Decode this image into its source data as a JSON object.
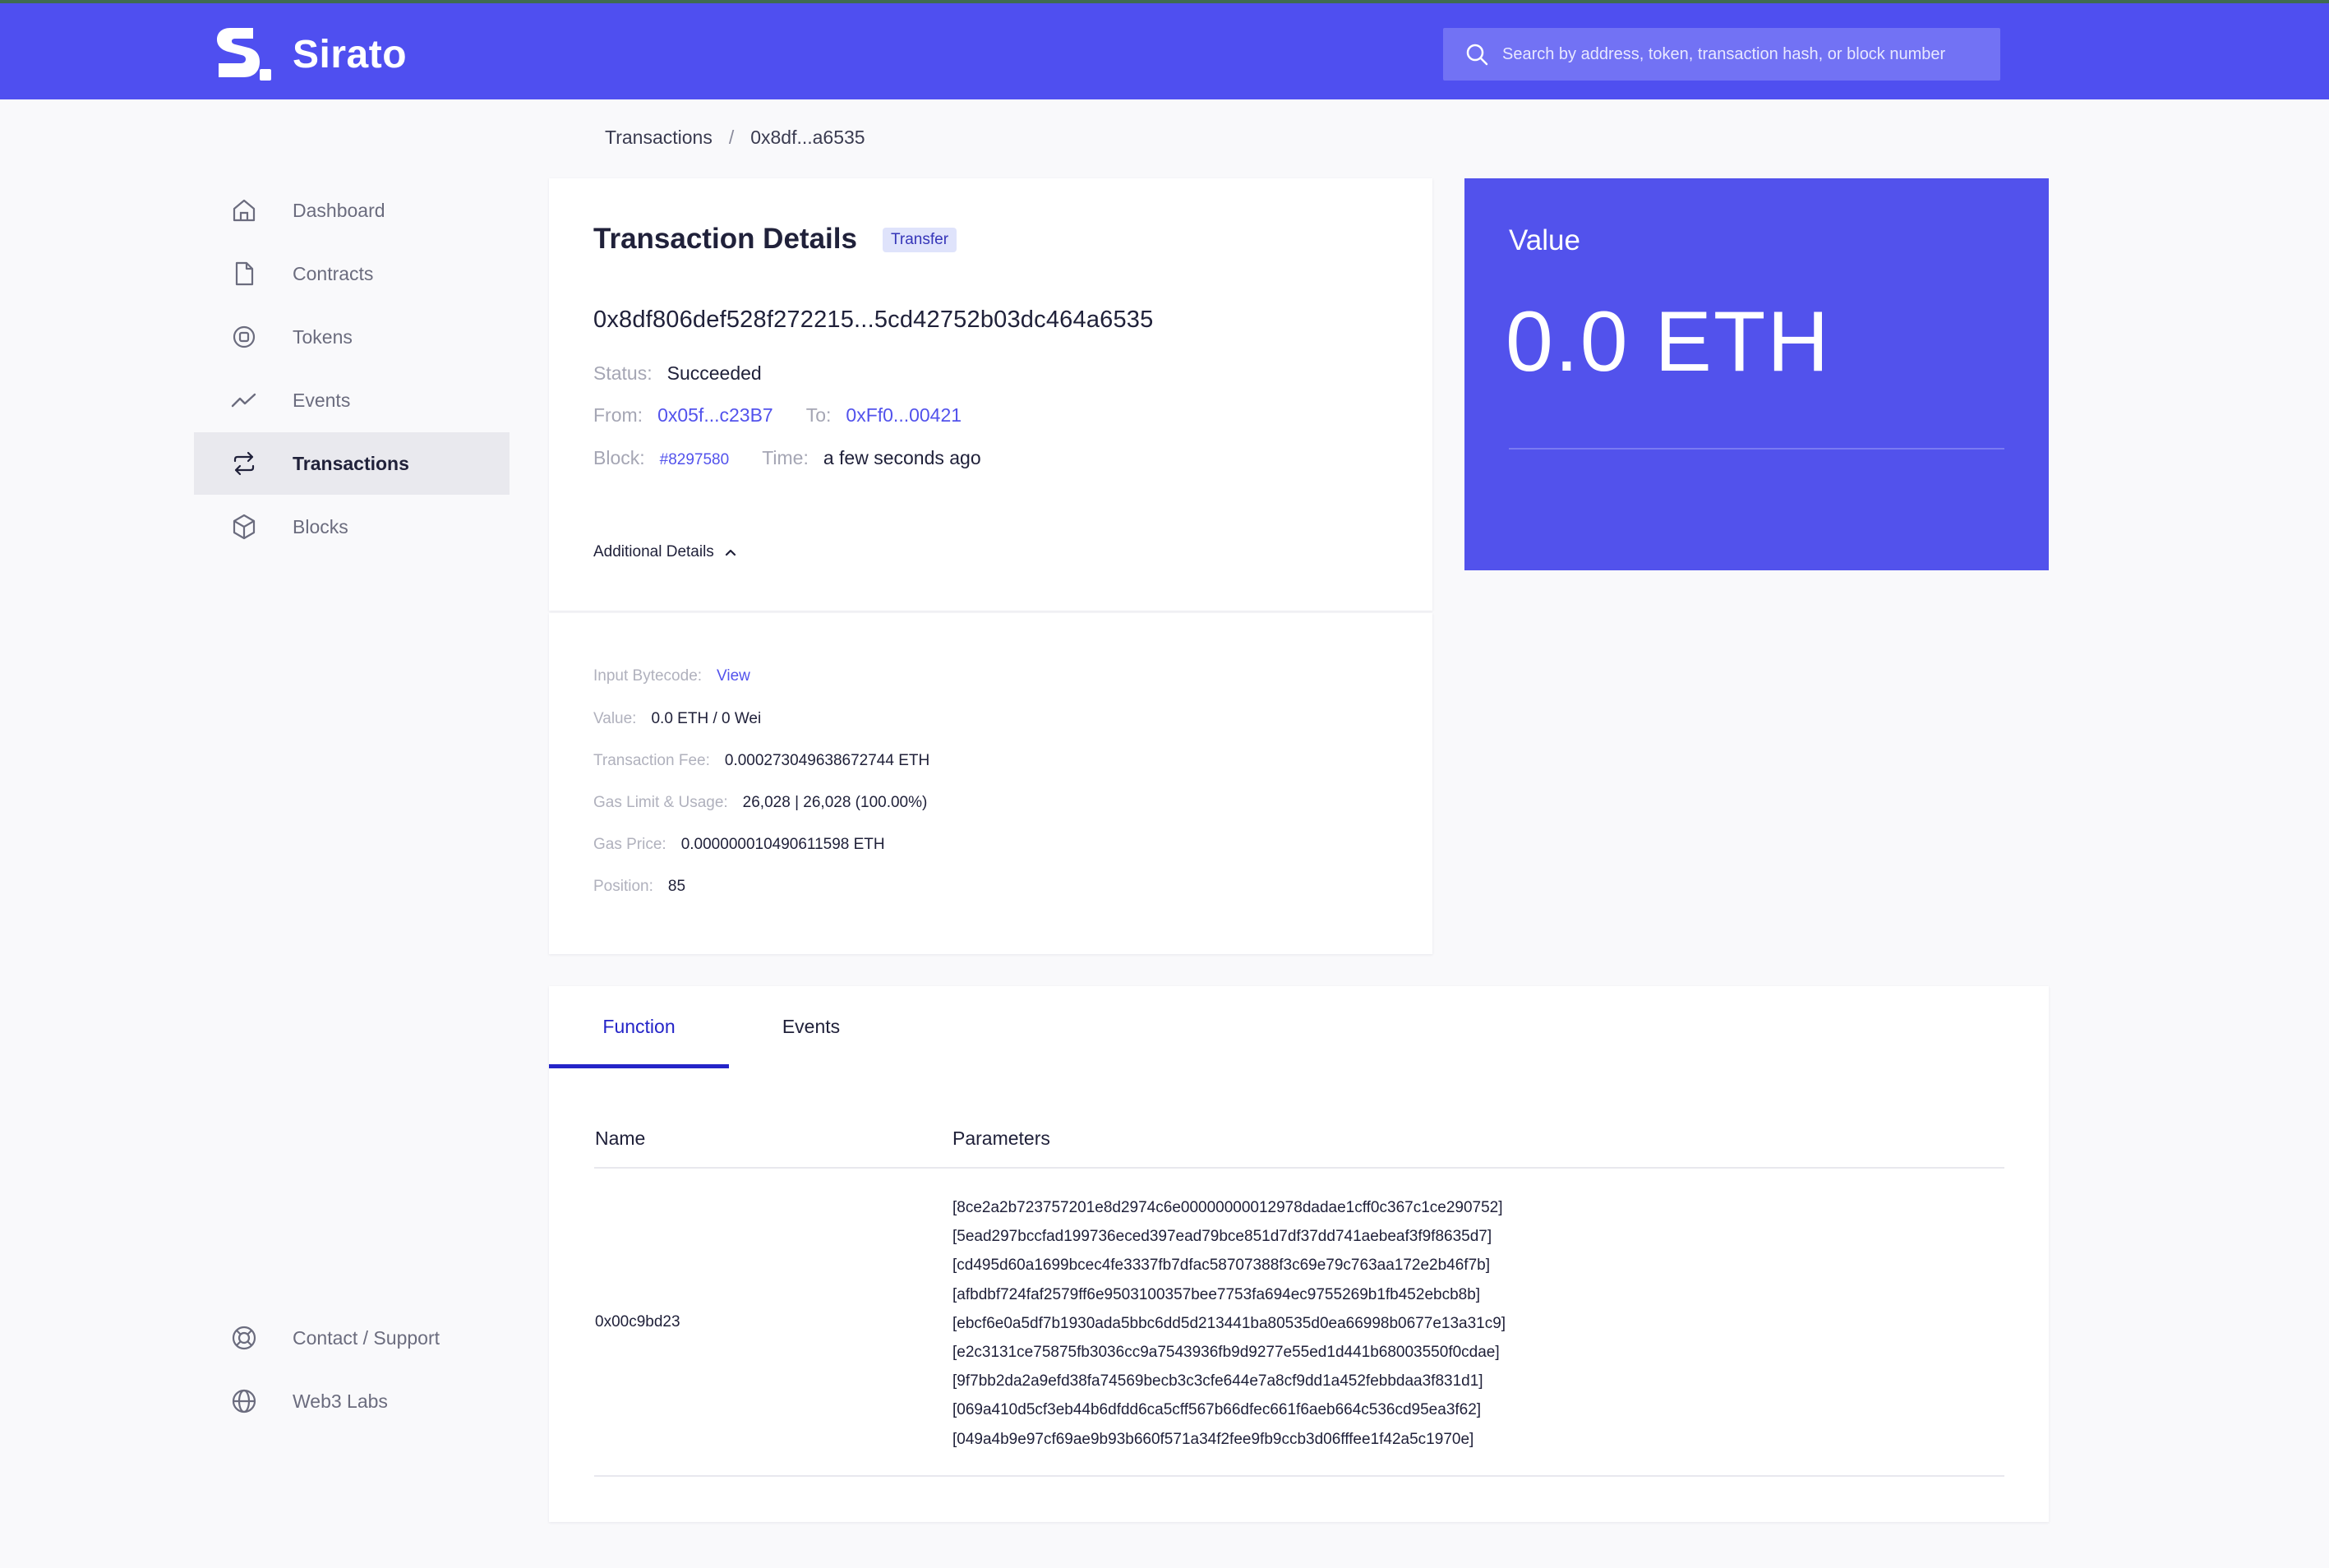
{
  "app": {
    "name": "Sirato",
    "brand_color": "#4f4ff0"
  },
  "search": {
    "placeholder": "Search by address, token, transaction hash, or block number",
    "icon": "search-icon"
  },
  "sidebar": {
    "items": [
      {
        "label": "Dashboard",
        "icon": "home-icon",
        "active": false
      },
      {
        "label": "Contracts",
        "icon": "document-icon",
        "active": false
      },
      {
        "label": "Tokens",
        "icon": "token-icon",
        "active": false
      },
      {
        "label": "Events",
        "icon": "trend-icon",
        "active": false
      },
      {
        "label": "Transactions",
        "icon": "transfer-icon",
        "active": true
      },
      {
        "label": "Blocks",
        "icon": "cube-icon",
        "active": false
      }
    ],
    "bottom_items": [
      {
        "label": "Contact / Support",
        "icon": "lifebuoy-icon"
      },
      {
        "label": "Web3 Labs",
        "icon": "globe-icon"
      }
    ]
  },
  "breadcrumb": {
    "items": [
      "Transactions",
      "0x8df...a6535"
    ],
    "separator": "/"
  },
  "details": {
    "title": "Transaction Details",
    "badge": "Transfer",
    "hash": "0x8df806def528f272215...5cd42752b03dc464a6535",
    "status_label": "Status:",
    "status_value": "Succeeded",
    "from_label": "From:",
    "from_value": "0x05f...c23B7",
    "to_label": "To:",
    "to_value": "0xFf0...00421",
    "block_label": "Block:",
    "block_value": "#8297580",
    "time_label": "Time:",
    "time_value": "a few seconds ago",
    "additional_toggle": "Additional Details"
  },
  "additional": {
    "input_bytecode_label": "Input Bytecode:",
    "input_bytecode_link": "View",
    "value_label": "Value:",
    "value_value": "0.0 ETH / 0 Wei",
    "fee_label": "Transaction Fee:",
    "fee_value": "0.000273049638672744 ETH",
    "gas_label": "Gas Limit & Usage:",
    "gas_value": "26,028 | 26,028 (100.00%)",
    "gas_price_label": "Gas Price:",
    "gas_price_value": "0.000000010490611598 ETH",
    "position_label": "Position:",
    "position_value": "85"
  },
  "value_card": {
    "title": "Value",
    "amount": "0.0 ETH",
    "color": "#5252ec"
  },
  "function_panel": {
    "tabs": [
      {
        "label": "Function",
        "active": true
      },
      {
        "label": "Events",
        "active": false
      }
    ],
    "columns": [
      "Name",
      "Parameters"
    ],
    "rows": [
      {
        "name": "0x00c9bd23",
        "parameters": [
          "[8ce2a2b723757201e8d2974c6e00000000012978dadae1cff0c367c1ce290752]",
          "[5ead297bccfad199736eced397ead79bce851d7df37dd741aebeaf3f9f8635d7]",
          "[cd495d60a1699bcec4fe3337fb7dfac58707388f3c69e79c763aa172e2b46f7b]",
          "[afbdbf724faf2579ff6e9503100357bee7753fa694ec9755269b1fb452ebcb8b]",
          "[ebcf6e0a5df7b1930ada5bbc6dd5d213441ba80535d0ea66998b0677e13a31c9]",
          "[e2c3131ce75875fb3036cc9a7543936fb9d9277e55ed1d441b68003550f0cdae]",
          "[9f7bb2da2a9efd38fa74569becb3c3cfe644e7a8cf9dd1a452febbdaa3f831d1]",
          "[069a410d5cf3eb44b6dfdd6ca5cff567b66dfec661f6aeb664c536cd95ea3f62]",
          "[049a4b9e97cf69ae9b93b660f571a34f2fee9fb9ccb3d06fffee1f42a5c1970e]"
        ]
      }
    ]
  }
}
